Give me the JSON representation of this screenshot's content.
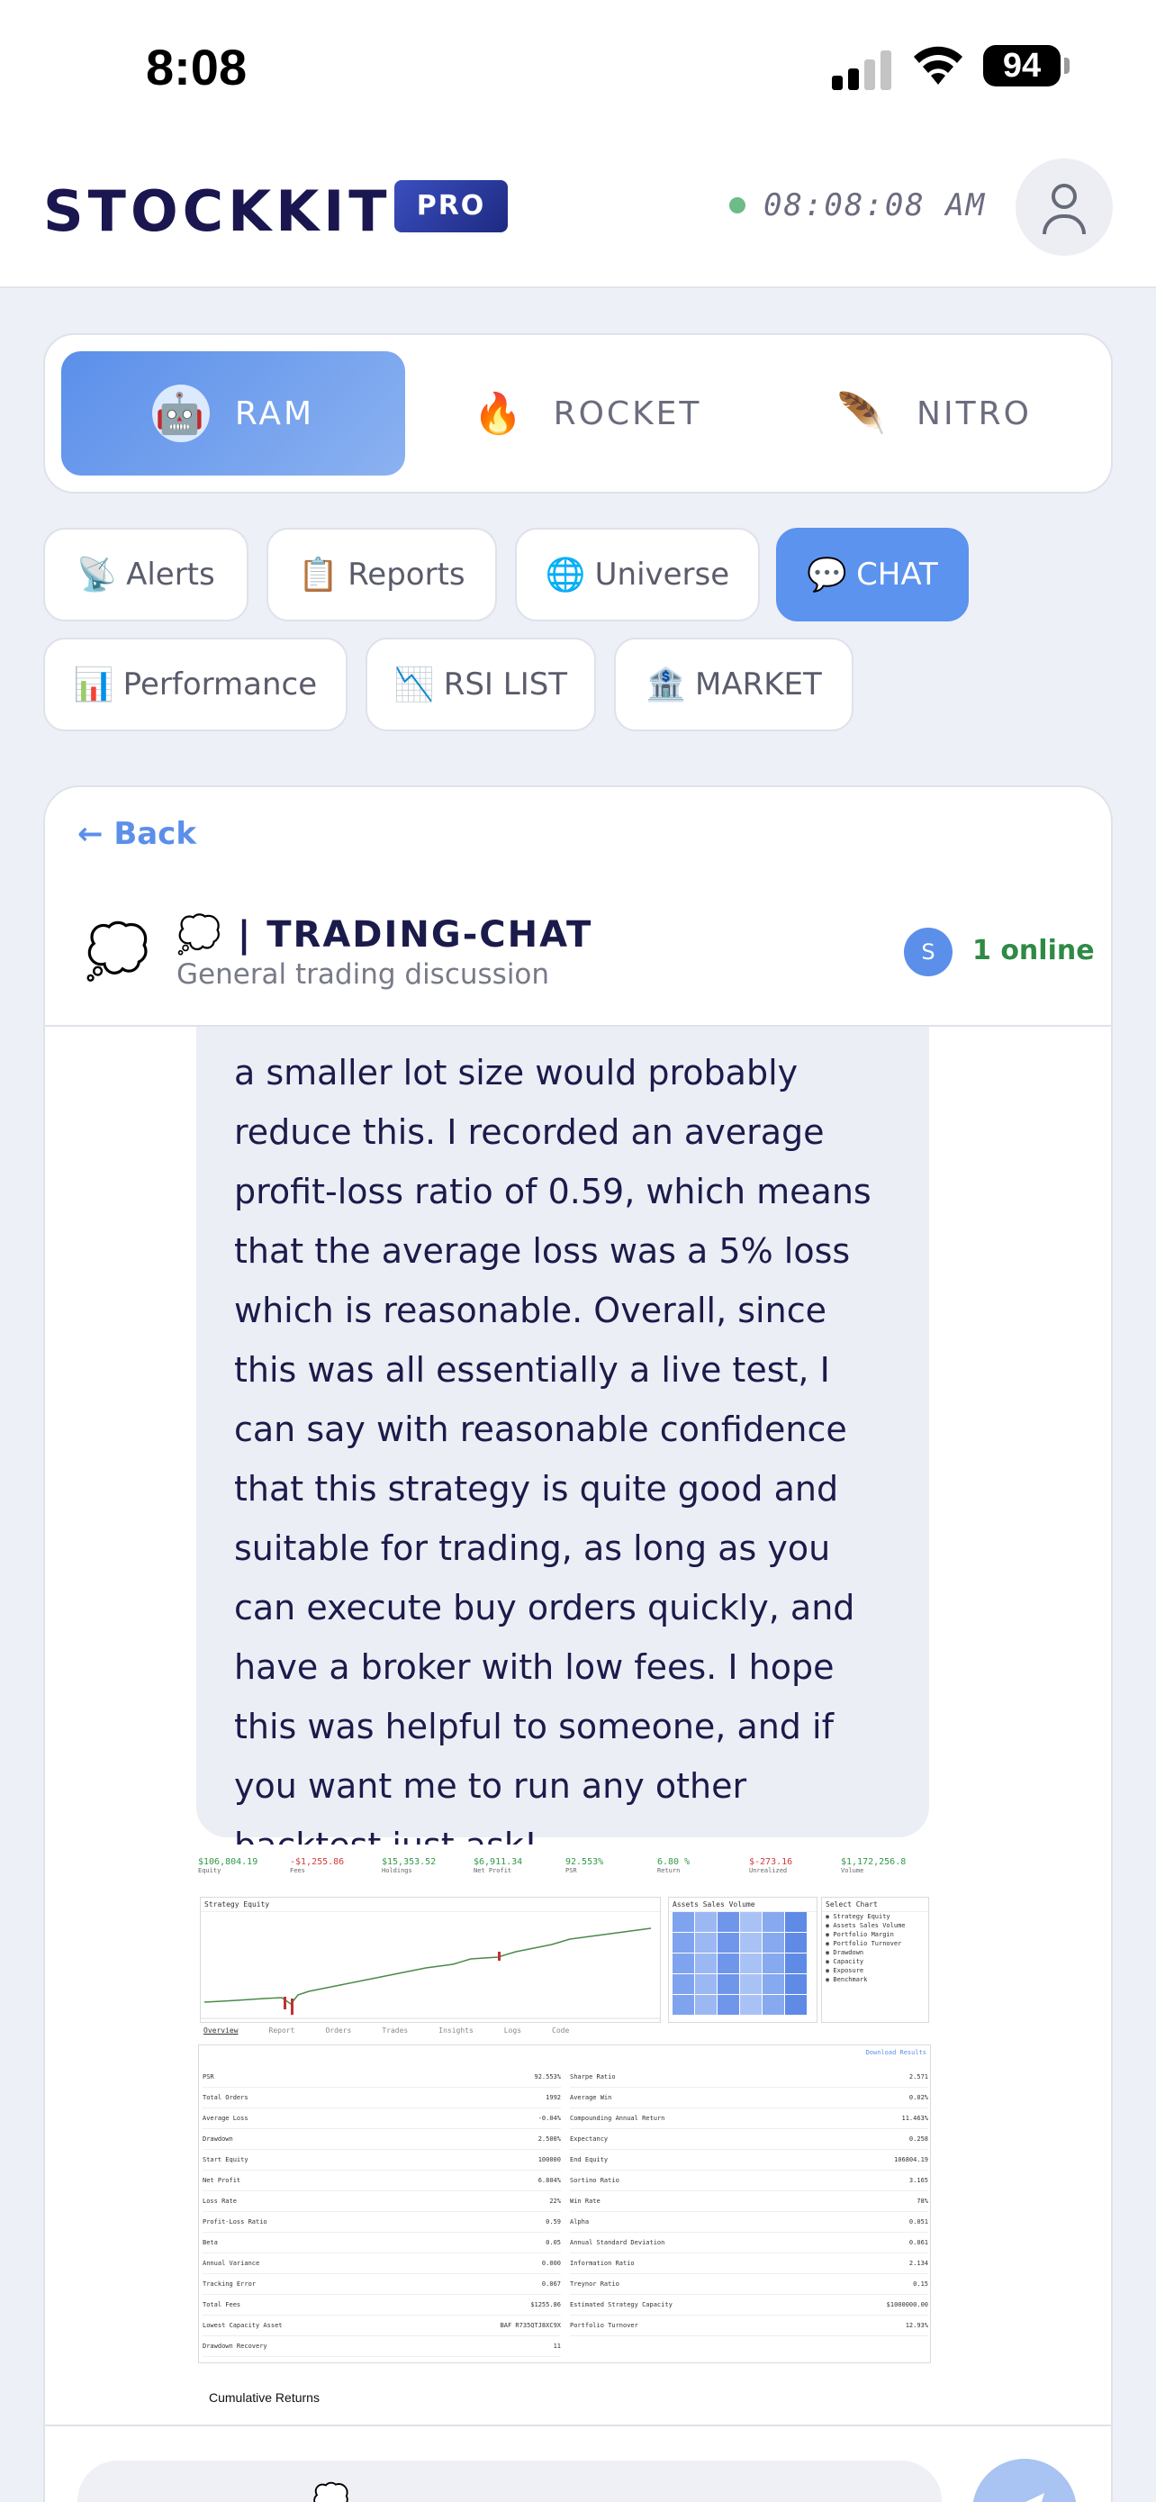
{
  "status_bar": {
    "time": "8:08",
    "battery": "94"
  },
  "header": {
    "logo": "STOCKKIT",
    "badge": "PRO",
    "clock": "08:08:08 AM"
  },
  "strategies": [
    {
      "label": "RAM",
      "icon": "robot-icon",
      "active": true
    },
    {
      "label": "ROCKET",
      "icon": "flame-rocket-icon",
      "active": false
    },
    {
      "label": "NITRO",
      "icon": "feather-icon",
      "active": false
    }
  ],
  "menu": {
    "row1": [
      {
        "icon": "📡",
        "label": "Alerts",
        "active": false
      },
      {
        "icon": "📋",
        "label": "Reports",
        "active": false
      },
      {
        "icon": "🌐",
        "label": "Universe",
        "active": false
      },
      {
        "icon": "💬",
        "label": "CHAT",
        "active": true
      }
    ],
    "row2": [
      {
        "icon": "📊",
        "label": "Performance",
        "active": false
      },
      {
        "icon": "📉",
        "label": "RSI LIST",
        "active": false
      },
      {
        "icon": "🏦",
        "label": "MARKET",
        "active": false
      }
    ]
  },
  "chat": {
    "back_label": "← Back",
    "room_icon": "💭",
    "room_title": "💭 | TRADING-CHAT",
    "room_subtitle": "General trading discussion",
    "online_avatar": "S",
    "online_text": "1 online",
    "message_text": "a smaller lot size would probably reduce this. I recorded an average profit-loss ratio of 0.59, which means that the average loss was a 5% loss which is reasonable. Overall, since this was all essentially a live test, I can say with reasonable confidence that this strategy is quite good and suitable for trading, as long as you can execute buy orders quickly, and have a broker with low fees. I hope this was helpful to someone, and if you want me to run any other backtest just ask!",
    "input_placeholder": "💭 ..."
  },
  "attachment": {
    "stats": [
      {
        "value": "$106,804.19",
        "label": "Equity",
        "color": "#2e9a46"
      },
      {
        "value": "-$1,255.86",
        "label": "Fees",
        "color": "#d43a3a"
      },
      {
        "value": "$15,353.52",
        "label": "Holdings",
        "color": "#2e9a46"
      },
      {
        "value": "$6,911.34",
        "label": "Net Profit",
        "color": "#2e9a46"
      },
      {
        "value": "92.553%",
        "label": "PSR",
        "color": "#2e9a46"
      },
      {
        "value": "6.80 %",
        "label": "Return",
        "color": "#2e9a46"
      },
      {
        "value": "$-273.16",
        "label": "Unrealized",
        "color": "#d43a3a"
      },
      {
        "value": "$1,172,256.8",
        "label": "Volume",
        "color": "#2e9a46"
      }
    ],
    "equity_panel_title": "Strategy Equity",
    "volume_panel_title": "Assets Sales Volume",
    "select_chart_title": "Select Chart",
    "chart_options": [
      "Strategy Equity",
      "Assets Sales Volume",
      "Portfolio Margin",
      "Portfolio Turnover",
      "Drawdown",
      "Capacity",
      "Exposure",
      "Benchmark"
    ],
    "tabs": [
      "Overview",
      "Report",
      "Orders",
      "Trades",
      "Insights",
      "Logs",
      "Code"
    ],
    "download_label": "Download Results",
    "left_stats": [
      [
        "PSR",
        "92.553%"
      ],
      [
        "Total Orders",
        "1992"
      ],
      [
        "Average Loss",
        "-0.04%"
      ],
      [
        "Drawdown",
        "2.500%"
      ],
      [
        "Start Equity",
        "100000"
      ],
      [
        "Net Profit",
        "6.804%"
      ],
      [
        "Loss Rate",
        "22%"
      ],
      [
        "Profit-Loss Ratio",
        "0.59"
      ],
      [
        "Beta",
        "0.05"
      ],
      [
        "Annual Variance",
        "0.000"
      ],
      [
        "Tracking Error",
        "0.067"
      ],
      [
        "Total Fees",
        "$1255.86"
      ],
      [
        "Lowest Capacity Asset",
        "BAF R735QTJ8XC9X"
      ],
      [
        "Drawdown Recovery",
        "11"
      ]
    ],
    "right_stats": [
      [
        "Sharpe Ratio",
        "2.571"
      ],
      [
        "Average Win",
        "0.02%"
      ],
      [
        "Compounding Annual Return",
        "11.463%"
      ],
      [
        "Expectancy",
        "0.258"
      ],
      [
        "End Equity",
        "106804.19"
      ],
      [
        "Sortino Ratio",
        "3.165"
      ],
      [
        "Win Rate",
        "78%"
      ],
      [
        "Alpha",
        "0.051"
      ],
      [
        "Annual Standard Deviation",
        "0.061"
      ],
      [
        "Information Ratio",
        "2.134"
      ],
      [
        "Treynor Ratio",
        "0.15"
      ],
      [
        "Estimated Strategy Capacity",
        "$1000000.00"
      ],
      [
        "Portfolio Turnover",
        "12.93%"
      ]
    ],
    "cumulative_label": "Cumulative Returns"
  },
  "colors": {
    "accent": "#5b8fea",
    "online": "#2f8a45",
    "navy": "#1b1b4b"
  }
}
